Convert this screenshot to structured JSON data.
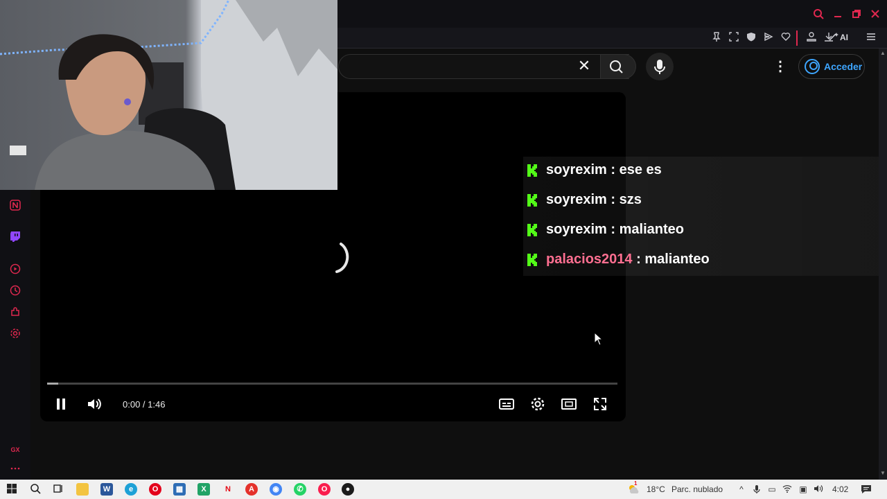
{
  "browser": {
    "toolbar_ai_label": "AI"
  },
  "youtube": {
    "clear_glyph": "✕",
    "more_glyph": "⋮",
    "signin_label": "Acceder"
  },
  "player": {
    "time_display": "0:00 / 1:46",
    "progress": 0.02
  },
  "chat": [
    {
      "user": "soyrexim",
      "message": "ese es",
      "user_color": "#ffffff"
    },
    {
      "user": "soyrexim",
      "message": "szs",
      "user_color": "#ffffff"
    },
    {
      "user": "soyrexim",
      "message": "malianteo",
      "user_color": "#ffffff"
    },
    {
      "user": "palacios2014",
      "message": "malianteo",
      "user_color": "#ff6f91"
    }
  ],
  "chat_separator": " : ",
  "sidebar": {
    "bottom_label": "GX"
  },
  "taskbar": {
    "weather_temp": "18°C",
    "weather_desc": "Parc. nublado",
    "clock": "4:02",
    "notification_count": "1"
  },
  "colors": {
    "accent": "#e0284f",
    "kick_green": "#53fc18",
    "link_blue": "#3ea6ff"
  }
}
